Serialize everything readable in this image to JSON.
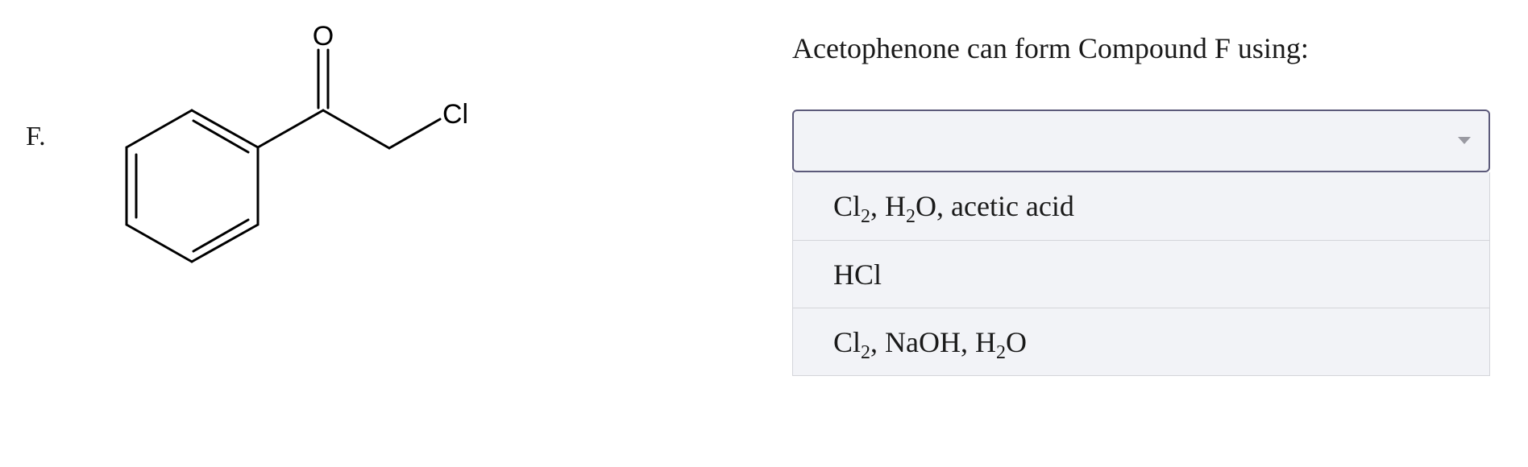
{
  "question": {
    "label": "F.",
    "prompt": "Acetophenone can form Compound F using:"
  },
  "structure": {
    "atom_labels": {
      "oxygen": "O",
      "chlorine": "Cl"
    }
  },
  "dropdown": {
    "selected_value": "",
    "caret_icon": "caret-down-icon",
    "options": [
      {
        "label": "Cl2, H2O, acetic acid",
        "parts": [
          "Cl",
          "2",
          ", H",
          "2",
          "O, acetic acid"
        ]
      },
      {
        "label": "HCl",
        "parts": [
          "HCl"
        ]
      },
      {
        "label": "Cl2, NaOH, H2O",
        "parts": [
          "Cl",
          "2",
          ", NaOH, H",
          "2",
          "O"
        ]
      }
    ]
  }
}
